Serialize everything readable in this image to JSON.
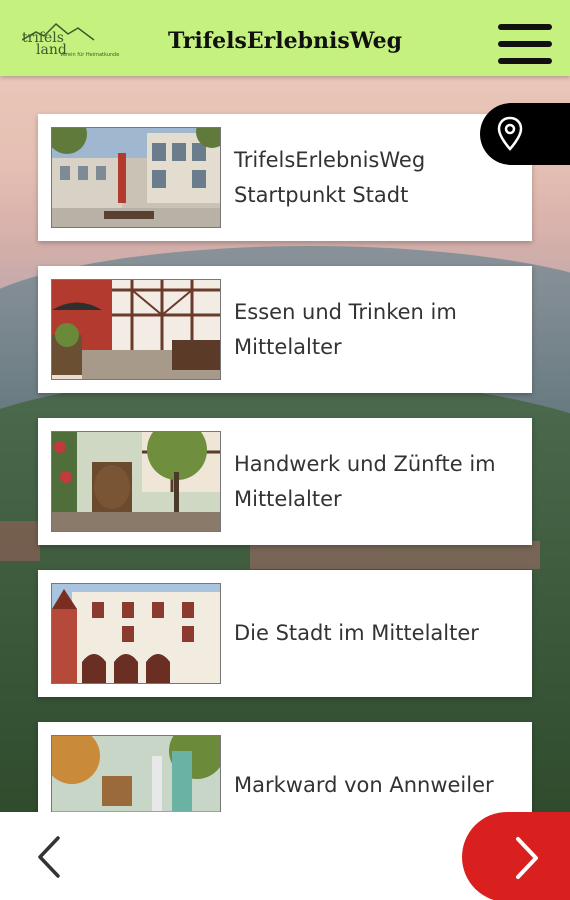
{
  "header": {
    "title": "TrifelsErlebnisWeg",
    "logo_text": "trifels\nland",
    "logo_sub": "Verein für Heimatkunde"
  },
  "icons": {
    "menu": "hamburger-menu-icon",
    "location": "map-pin-icon",
    "prev": "chevron-left-icon",
    "next": "chevron-right-icon"
  },
  "colors": {
    "header_bg": "#c5f27e",
    "next_button": "#d9201e",
    "location_tab": "#000000"
  },
  "stations": [
    {
      "line1": "TrifelsErlebnisWeg",
      "line2": "Startpunkt Stadt"
    },
    {
      "line1": "Essen und Trinken im",
      "line2": "Mittelalter"
    },
    {
      "line1": "Handwerk und Zünfte im",
      "line2": "Mittelalter"
    },
    {
      "line1": "Die Stadt im Mittelalter",
      "line2": ""
    },
    {
      "line1": "Markward von Annweiler",
      "line2": ""
    }
  ]
}
